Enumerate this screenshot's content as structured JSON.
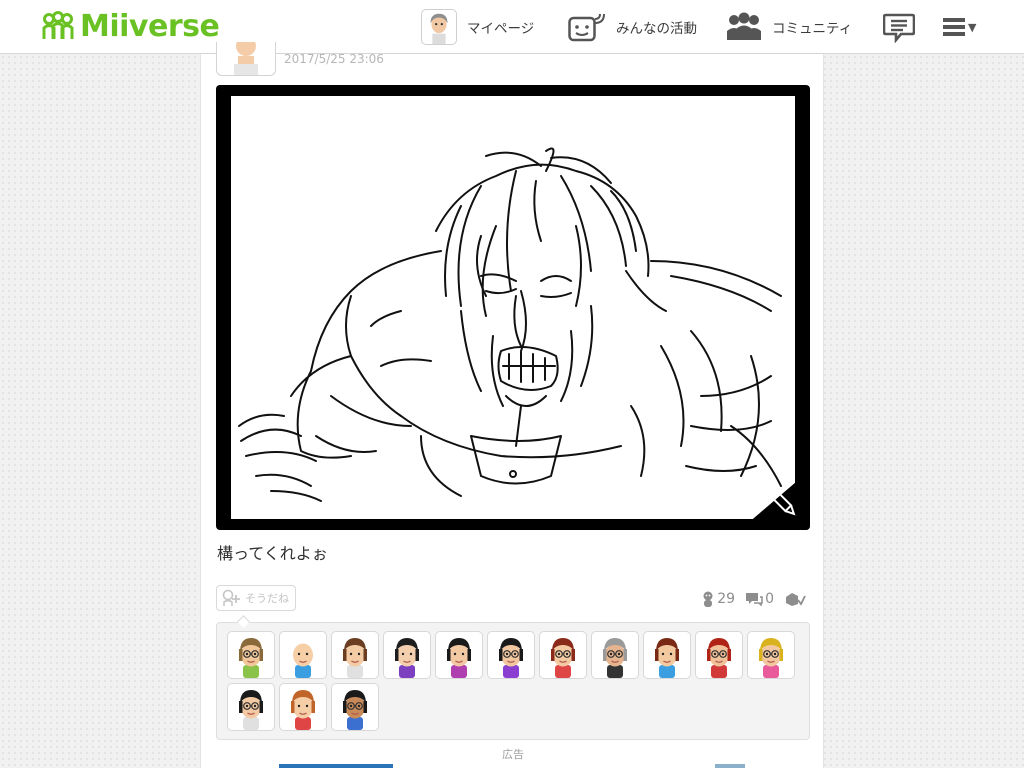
{
  "header": {
    "logo_text": "Miiverse",
    "nav": [
      {
        "label": "マイページ",
        "icon": "my-page-avatar-icon"
      },
      {
        "label": "みんなの活動",
        "icon": "activity-feed-icon"
      },
      {
        "label": "コミュニティ",
        "icon": "community-icon"
      }
    ],
    "messages_icon": "messages-icon",
    "menu_icon": "hamburger-menu-icon",
    "brand_color": "#6ac124"
  },
  "post": {
    "timestamp": "2017/5/25 23:06",
    "body": "構ってくれよぉ",
    "yeah_label": "そうだね",
    "yeah_count": "29",
    "comment_count": "0",
    "screenshot_alt": "hand-drawn sketch of a crying, grimacing character"
  },
  "yeah_users": [
    {
      "hair": "#8a6a3a",
      "skin": "#f1c79a",
      "shirt": "#8bc34a",
      "glasses": true
    },
    {
      "hair": "none",
      "skin": "#f6cfa6",
      "shirt": "#3b9ee0",
      "glasses": false
    },
    {
      "hair": "#6b3e22",
      "skin": "#f3cba4",
      "shirt": "#e0e0e0",
      "glasses": false
    },
    {
      "hair": "#1e1e1e",
      "skin": "#f4cfae",
      "shirt": "#7c3fbf",
      "glasses": false
    },
    {
      "hair": "#1a1a1a",
      "skin": "#f2c9a3",
      "shirt": "#b03fb0",
      "glasses": false
    },
    {
      "hair": "#1a1a1a",
      "skin": "#f2c7a0",
      "shirt": "#8a3fd1",
      "glasses": true
    },
    {
      "hair": "#8a2a1a",
      "skin": "#f4caa2",
      "shirt": "#e04545",
      "glasses": true
    },
    {
      "hair": "#9a9a9a",
      "skin": "#e6b48e",
      "shirt": "#333333",
      "glasses": true
    },
    {
      "hair": "#7a2a14",
      "skin": "#f3c9a0",
      "shirt": "#3b9ee0",
      "glasses": false
    },
    {
      "hair": "#b02418",
      "skin": "#f1c199",
      "shirt": "#d23a3a",
      "glasses": true
    },
    {
      "hair": "#d9b21f",
      "skin": "#f3c8a0",
      "shirt": "#e85a9a",
      "glasses": true
    },
    {
      "hair": "#1a1a1a",
      "skin": "#f2c9a3",
      "shirt": "#e0e0e0",
      "glasses": true
    },
    {
      "hair": "#c1642a",
      "skin": "#f5cda6",
      "shirt": "#e04545",
      "glasses": false
    },
    {
      "hair": "#1a1a1a",
      "skin": "#c98a5a",
      "shirt": "#3b6fd0",
      "glasses": true
    }
  ],
  "ad": {
    "label": "広告"
  }
}
